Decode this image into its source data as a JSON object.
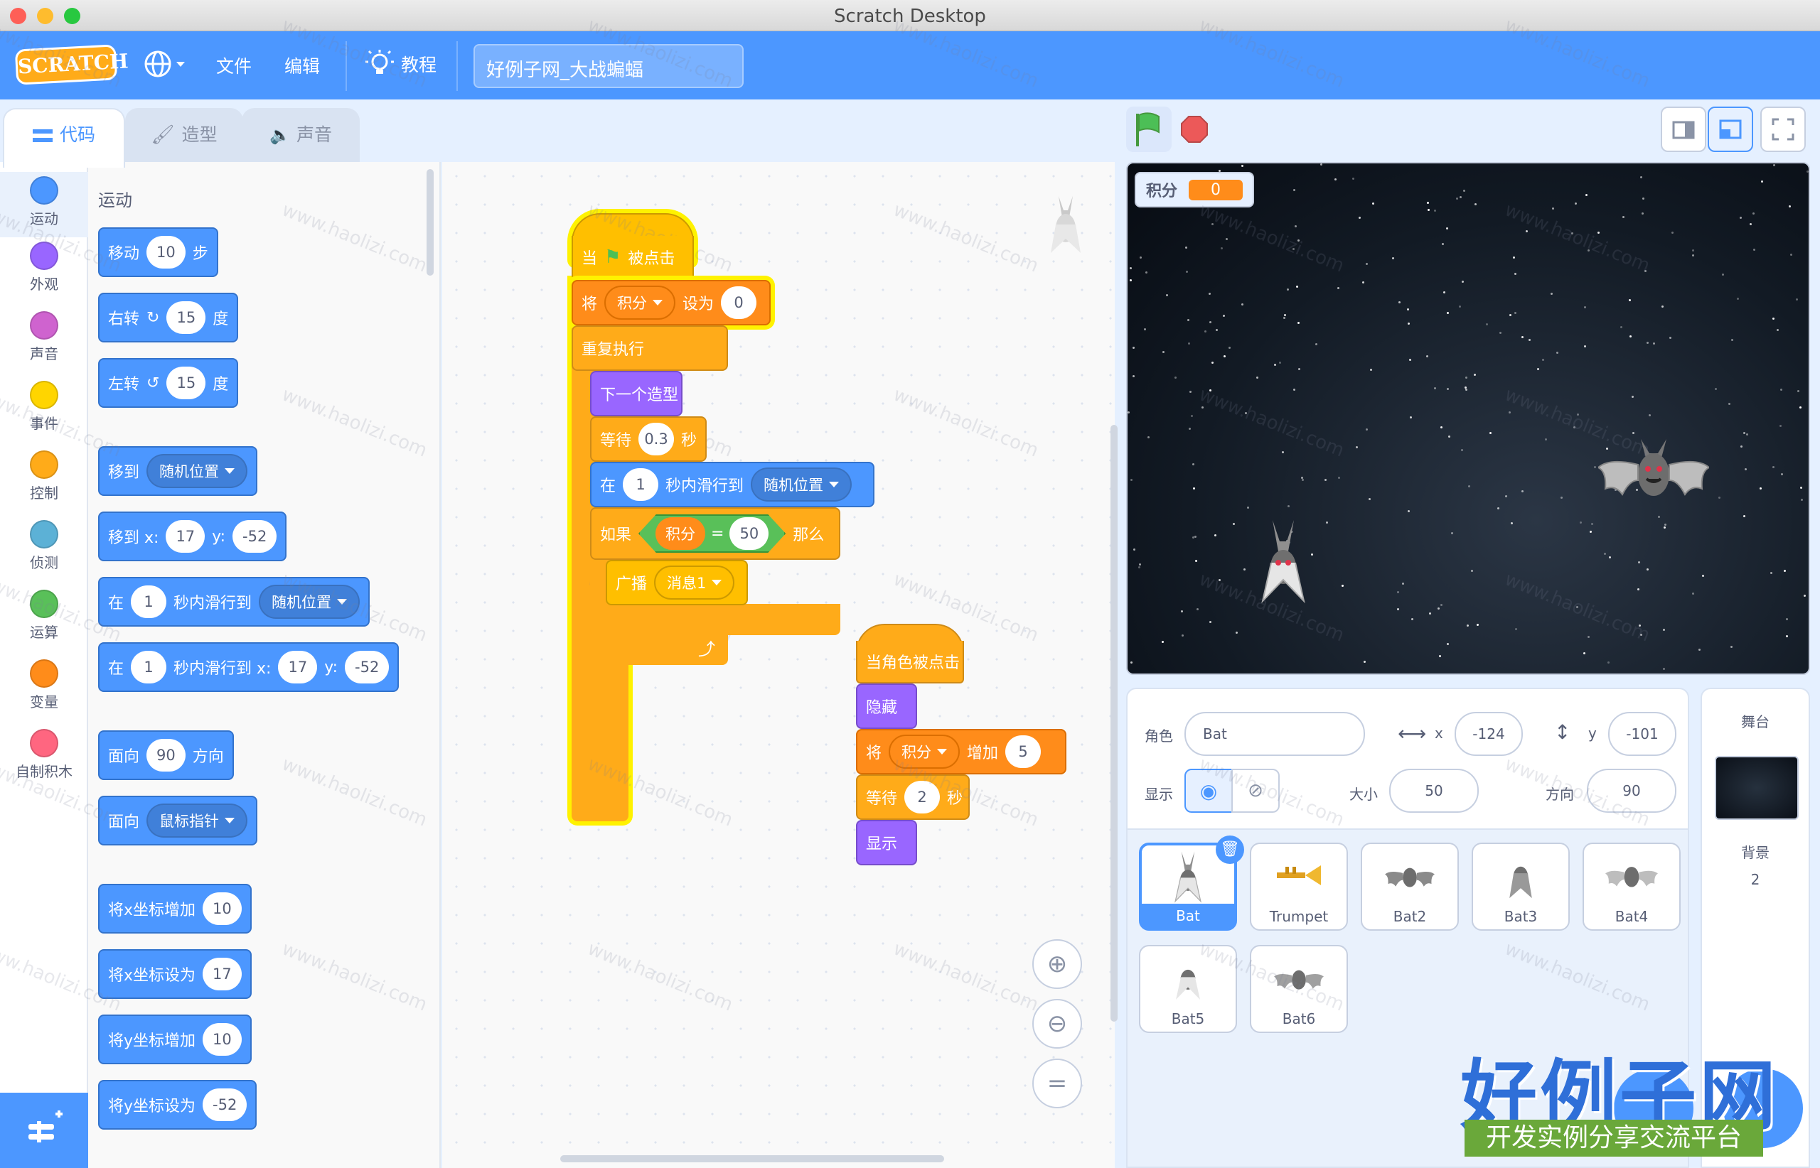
{
  "window": {
    "title": "Scratch Desktop"
  },
  "menu": {
    "logo": "SCRATCH",
    "file": "文件",
    "edit": "编辑",
    "tutorials": "教程",
    "project_name": "好例子网_大战蝙蝠"
  },
  "tabs": {
    "code": "代码",
    "costumes": "造型",
    "sounds": "声音"
  },
  "categories": [
    {
      "label": "运动",
      "color": "#4c97ff"
    },
    {
      "label": "外观",
      "color": "#9966ff"
    },
    {
      "label": "声音",
      "color": "#cf63cf"
    },
    {
      "label": "事件",
      "color": "#ffd500"
    },
    {
      "label": "控制",
      "color": "#ffab19"
    },
    {
      "label": "侦测",
      "color": "#5cb1d6"
    },
    {
      "label": "运算",
      "color": "#59c059"
    },
    {
      "label": "变量",
      "color": "#ff8c1a"
    },
    {
      "label": "自制积木",
      "color": "#ff6680"
    }
  ],
  "palette": {
    "heading": "运动",
    "move": {
      "a": "移动",
      "v": "10",
      "b": "步"
    },
    "turn_right": {
      "a": "右转",
      "v": "15",
      "b": "度"
    },
    "turn_left": {
      "a": "左转",
      "v": "15",
      "b": "度"
    },
    "goto": {
      "a": "移到",
      "dd": "随机位置"
    },
    "goto_xy": {
      "a": "移到 x:",
      "x": "17",
      "b": "y:",
      "y": "-52"
    },
    "glide": {
      "a": "在",
      "v": "1",
      "b": "秒内滑行到",
      "dd": "随机位置"
    },
    "glide_xy": {
      "a": "在",
      "v": "1",
      "b": "秒内滑行到 x:",
      "x": "17",
      "c": "y:",
      "y": "-52"
    },
    "point_dir": {
      "a": "面向",
      "v": "90",
      "b": "方向"
    },
    "point_towards": {
      "a": "面向",
      "dd": "鼠标指针"
    },
    "change_x": {
      "a": "将x坐标增加",
      "v": "10"
    },
    "set_x": {
      "a": "将x坐标设为",
      "v": "17"
    },
    "change_y": {
      "a": "将y坐标增加",
      "v": "10"
    },
    "set_y": {
      "a": "将y坐标设为",
      "v": "-52"
    }
  },
  "script1": {
    "hat_a": "当",
    "hat_b": "被点击",
    "set_a": "将",
    "set_var": "积分",
    "set_b": "设为",
    "set_v": "0",
    "forever": "重复执行",
    "next_costume": "下一个造型",
    "wait_a": "等待",
    "wait_v": "0.3",
    "wait_b": "秒",
    "glide_a": "在",
    "glide_v": "1",
    "glide_b": "秒内滑行到",
    "glide_dd": "随机位置",
    "if_a": "如果",
    "if_var": "积分",
    "if_eq": "=",
    "if_v": "50",
    "if_b": "那么",
    "broadcast_a": "广播",
    "broadcast_dd": "消息1"
  },
  "script2": {
    "hat": "当角色被点击",
    "hide": "隐藏",
    "change_a": "将",
    "change_var": "积分",
    "change_b": "增加",
    "change_v": "5",
    "wait_a": "等待",
    "wait_v": "2",
    "wait_b": "秒",
    "show": "显示"
  },
  "stage": {
    "monitor_label": "积分",
    "monitor_value": "0"
  },
  "sprite_info": {
    "sprite_label": "角色",
    "sprite_name": "Bat",
    "x_label": "x",
    "x": "-124",
    "y_label": "y",
    "y": "-101",
    "show_label": "显示",
    "size_label": "大小",
    "size": "50",
    "direction_label": "方向",
    "direction": "90"
  },
  "sprites": [
    "Bat",
    "Trumpet",
    "Bat2",
    "Bat3",
    "Bat4",
    "Bat5",
    "Bat6"
  ],
  "stage_pane": {
    "title": "舞台",
    "backdrops_label": "背景",
    "backdrops_count": "2"
  },
  "watermark": {
    "url": "www.haolizi.com",
    "brand": "好例子网",
    "brand_sub": "开发实例分享交流平台"
  }
}
